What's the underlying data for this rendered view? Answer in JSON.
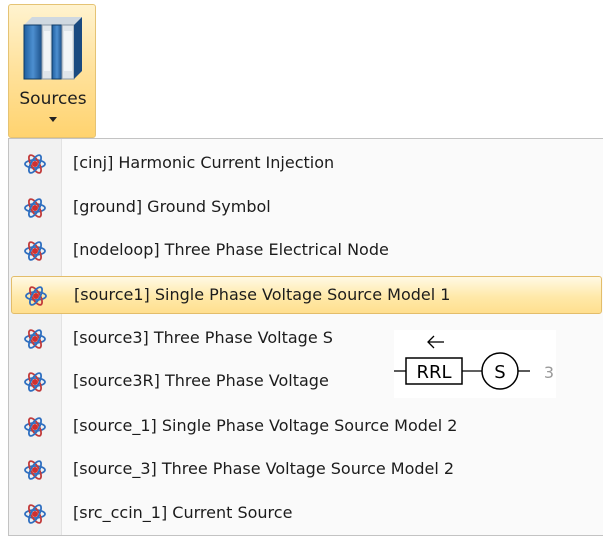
{
  "ribbon": {
    "button_label": "Sources",
    "icon": "books-icon"
  },
  "menu": {
    "items": [
      {
        "label": "[cinj] Harmonic Current Injection",
        "icon": "atom-icon"
      },
      {
        "label": "[ground] Ground Symbol",
        "icon": "atom-icon"
      },
      {
        "label": "[nodeloop] Three Phase Electrical Node",
        "icon": "atom-icon"
      },
      {
        "label": "[source1] Single Phase Voltage Source Model 1",
        "icon": "atom-icon",
        "highlighted": true
      },
      {
        "label": "[source3] Three Phase Voltage S",
        "icon": "atom-icon"
      },
      {
        "label": "[source3R] Three Phase Voltage",
        "icon": "atom-icon"
      },
      {
        "label": "[source_1] Single Phase Voltage Source Model 2",
        "icon": "atom-icon"
      },
      {
        "label": "[source_3] Three Phase Voltage Source Model 2",
        "icon": "atom-icon"
      },
      {
        "label": "[src_ccin_1] Current Source",
        "icon": "atom-icon"
      }
    ]
  },
  "tooltip": {
    "block_label": "RRL",
    "source_symbol": "S",
    "truncated_suffix": "3"
  }
}
